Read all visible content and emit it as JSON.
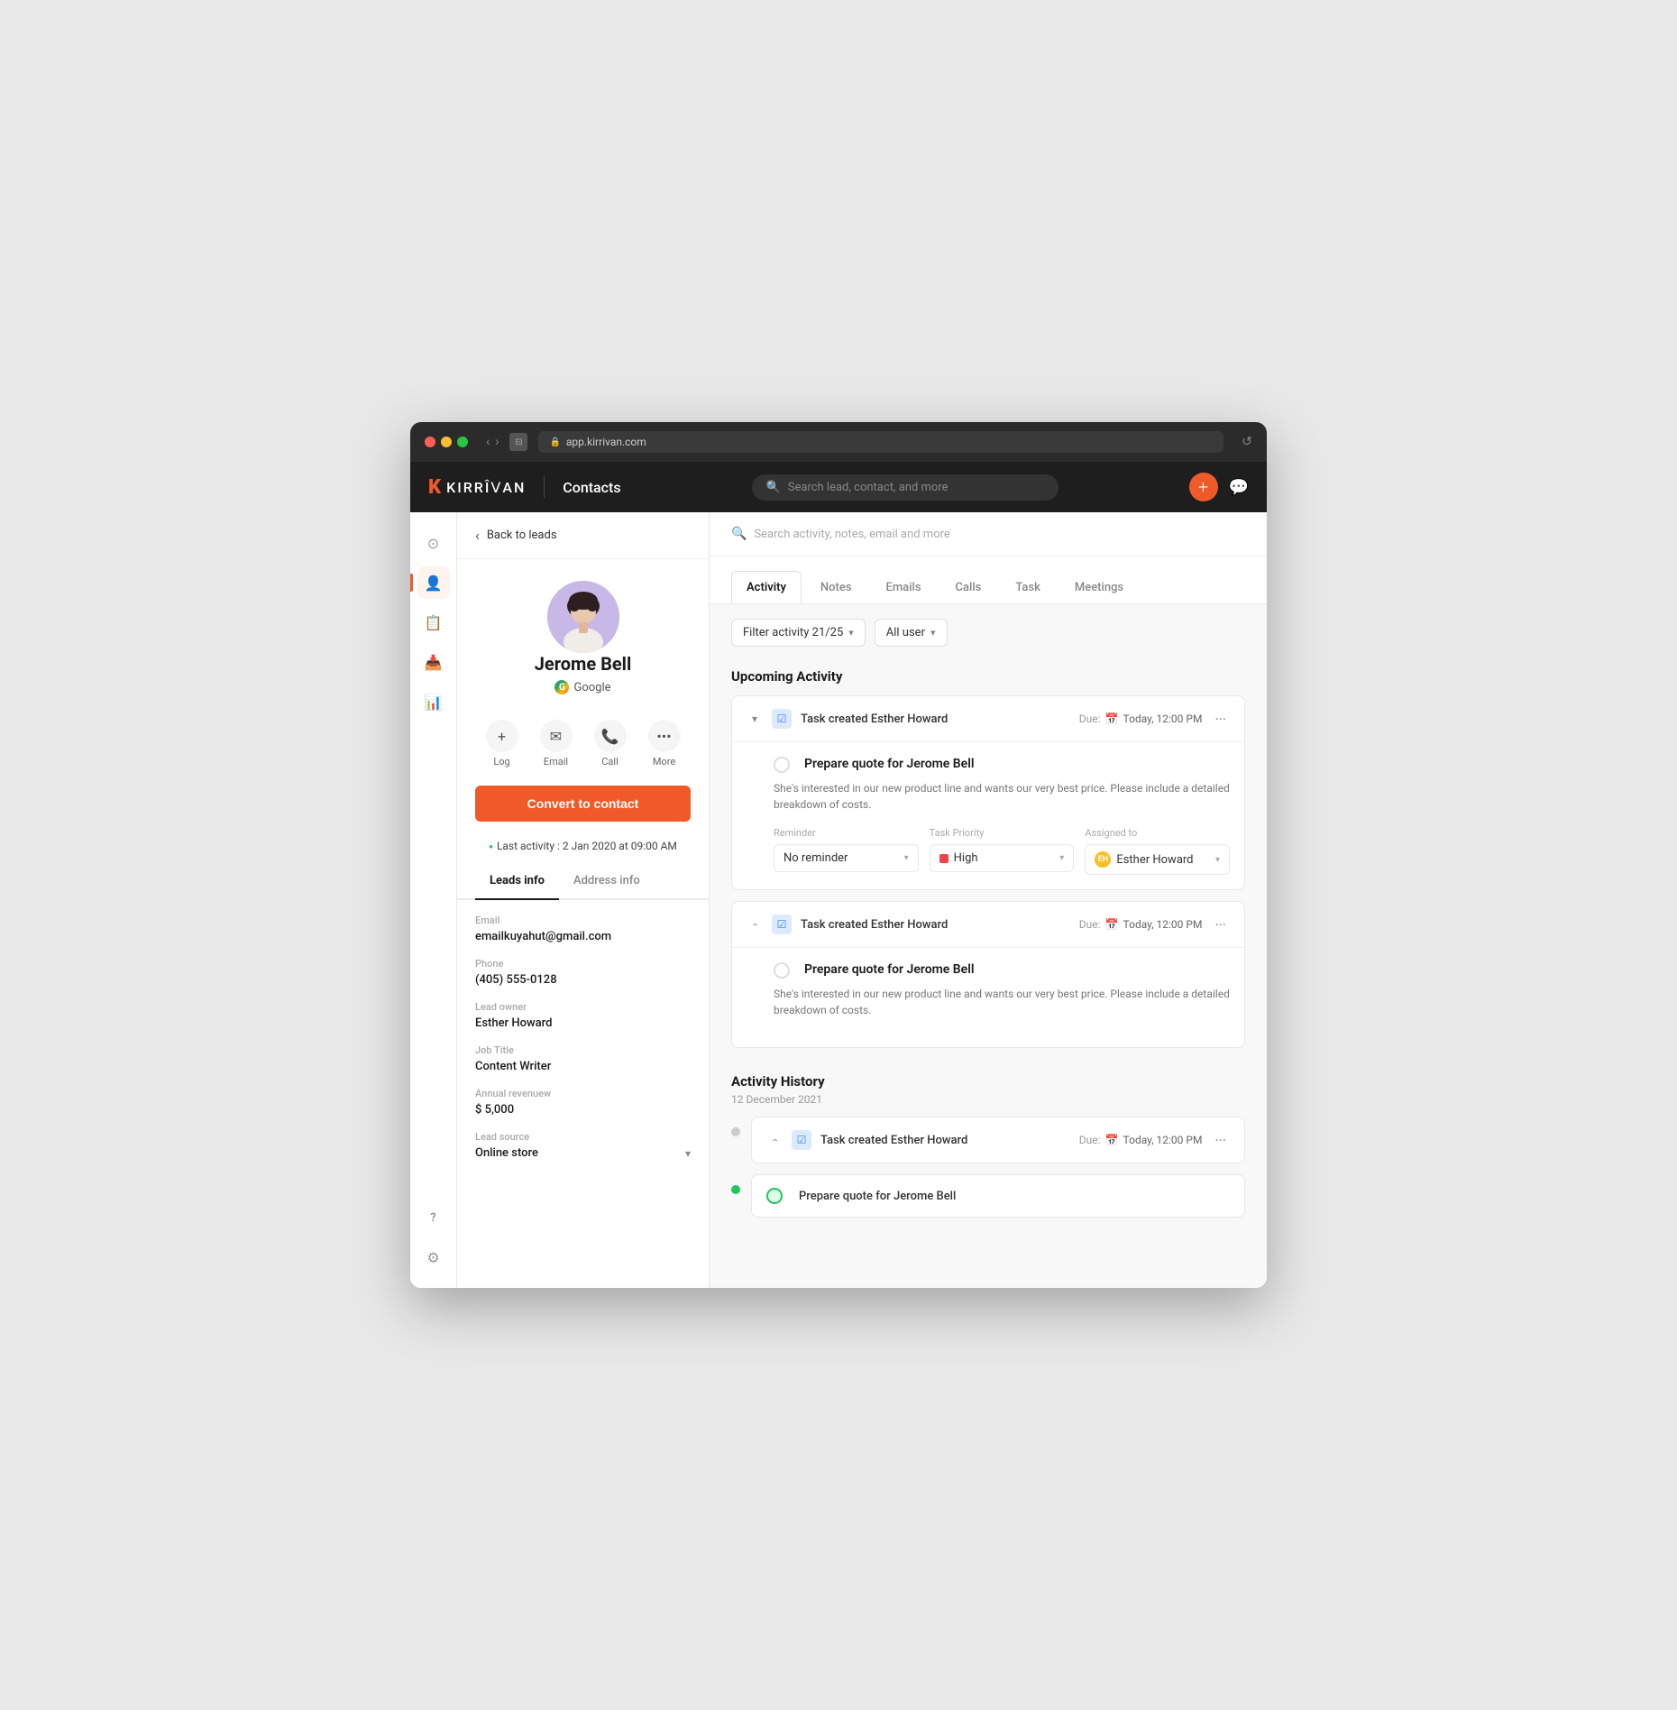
{
  "browser": {
    "url": "app.kirrivan.com",
    "traffic_lights": [
      "red",
      "yellow",
      "green"
    ]
  },
  "app": {
    "logo_k": "K",
    "logo_text": "KIRRIⅤAN",
    "page_title": "Contacts",
    "search_placeholder": "Search lead, contact, and more",
    "add_btn_label": "+",
    "chat_btn_label": "💬"
  },
  "sidebar": {
    "items": [
      {
        "name": "home",
        "icon": "⊙",
        "active": false
      },
      {
        "name": "contacts",
        "icon": "👤",
        "active": true
      },
      {
        "name": "documents",
        "icon": "📋",
        "active": false
      },
      {
        "name": "inbox",
        "icon": "📥",
        "active": false
      },
      {
        "name": "reports",
        "icon": "📊",
        "active": false
      }
    ],
    "bottom_items": [
      {
        "name": "help",
        "icon": "?"
      },
      {
        "name": "settings",
        "icon": "⚙"
      }
    ]
  },
  "contact_panel": {
    "back_label": "Back to leads",
    "contact_name": "Jerome Bell",
    "contact_source": "Google",
    "actions": [
      {
        "name": "log",
        "icon": "+",
        "label": "Log"
      },
      {
        "name": "email",
        "icon": "✉",
        "label": "Email"
      },
      {
        "name": "call",
        "icon": "📞",
        "label": "Call"
      },
      {
        "name": "more",
        "icon": "•••",
        "label": "More"
      }
    ],
    "convert_btn": "Convert to contact",
    "last_activity": "Last activity : 2 Jan 2020 at 09:00 AM",
    "tabs": [
      {
        "name": "leads_info",
        "label": "Leads info",
        "active": true
      },
      {
        "name": "address_info",
        "label": "Address info",
        "active": false
      }
    ],
    "fields": [
      {
        "name": "email",
        "label": "Email",
        "value": "emailkuyahut@gmail.com"
      },
      {
        "name": "phone",
        "label": "Phone",
        "value": "(405) 555-0128"
      },
      {
        "name": "lead_owner",
        "label": "Lead owner",
        "value": "Esther Howard"
      },
      {
        "name": "job_title",
        "label": "Job Title",
        "value": "Content Writer"
      },
      {
        "name": "annual_revenue",
        "label": "Annual revenuew",
        "value": "$ 5,000"
      },
      {
        "name": "lead_source",
        "label": "Lead source",
        "value": "Online store",
        "has_dropdown": true
      }
    ]
  },
  "main": {
    "search_placeholder": "Search activity, notes, email and more",
    "tabs": [
      {
        "name": "activity",
        "label": "Activity",
        "active": true
      },
      {
        "name": "notes",
        "label": "Notes",
        "active": false
      },
      {
        "name": "emails",
        "label": "Emails",
        "active": false
      },
      {
        "name": "calls",
        "label": "Calls",
        "active": false
      },
      {
        "name": "task",
        "label": "Task",
        "active": false
      },
      {
        "name": "meetings",
        "label": "Meetings",
        "active": false
      }
    ],
    "filters": [
      {
        "name": "filter_activity",
        "label": "Filter activity 21/25",
        "has_dropdown": true
      },
      {
        "name": "all_user",
        "label": "All user",
        "has_dropdown": true
      }
    ],
    "upcoming_section": {
      "title": "Upcoming Activity",
      "cards": [
        {
          "id": "card1",
          "expanded": true,
          "task_label": "Task created Esther Howard",
          "due_label": "Due:",
          "due_time": "Today, 12:00 PM",
          "task_title": "Prepare quote for Jerome Bell",
          "task_desc": "She's interested in our new product line and wants our very best price. Please include a detailed breakdown of costs.",
          "reminder_label": "Reminder",
          "reminder_value": "No reminder",
          "priority_label": "Task Priority",
          "priority_value": "High",
          "assigned_label": "Assigned to",
          "assigned_value": "Esther Howard"
        },
        {
          "id": "card2",
          "expanded": false,
          "task_label": "Task created Esther Howard",
          "due_label": "Due:",
          "due_time": "Today, 12:00 PM",
          "task_title": "Prepare quote for Jerome Bell",
          "task_desc": "She's interested in our new product line and wants our very best price. Please include a detailed breakdown of costs."
        }
      ]
    },
    "history_section": {
      "title": "Activity History",
      "date": "12 December 2021",
      "items": [
        {
          "id": "hist1",
          "dot_color": "gray",
          "task_label": "Task created Esther Howard",
          "due_label": "Due:",
          "due_time": "Today, 12:00 PM"
        },
        {
          "id": "hist2",
          "dot_color": "green",
          "task_title": "Prepare quote for Jerome Bell"
        }
      ]
    }
  }
}
